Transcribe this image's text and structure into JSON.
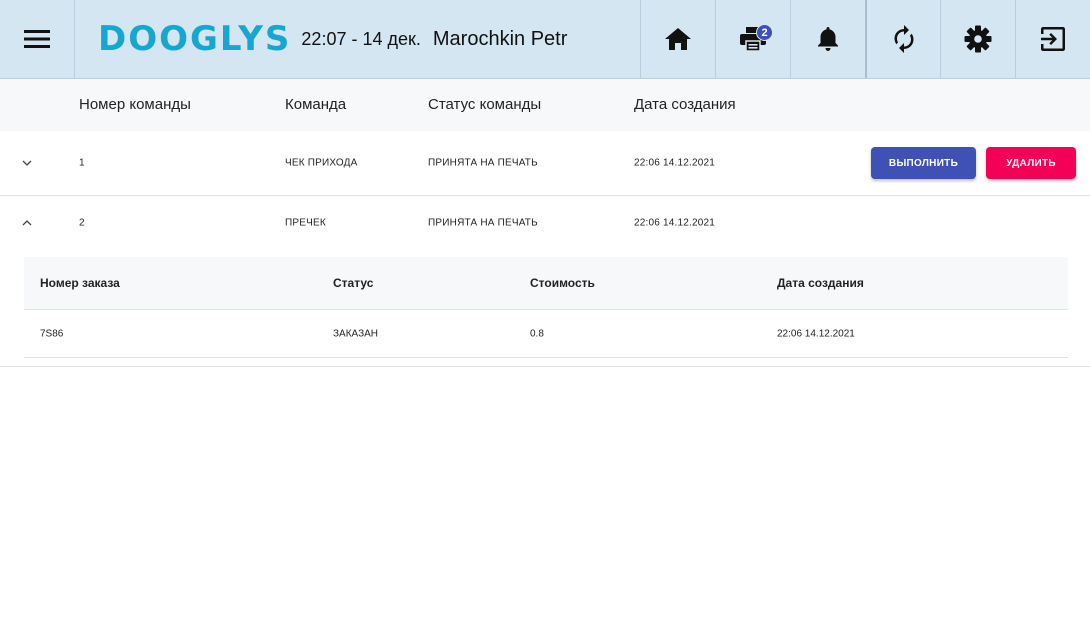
{
  "header": {
    "logo": "DOOGLYS",
    "datetime": "22:07 - 14 дек.",
    "username": "Marochkin Petr",
    "print_badge": "2",
    "icons": [
      "menu-icon",
      "home-icon",
      "printer-icon",
      "bell-icon",
      "sync-icon",
      "gear-icon",
      "logout-icon"
    ],
    "accent": "#17a6cf",
    "bg": "#d4e6f2"
  },
  "table": {
    "columns": [
      "Номер команды",
      "Команда",
      "Статус команды",
      "Дата создания"
    ],
    "rows": [
      {
        "number": "1",
        "command": "ЧЕК ПРИХОДА",
        "status": "ПРИНЯТА НА ПЕЧАТЬ",
        "created": "22:06 14.12.2021",
        "expanded": false,
        "exec_label": "ВЫПОЛНИТЬ",
        "delete_label": "УДАЛИТЬ"
      },
      {
        "number": "2",
        "command": "ПРЕЧЕК",
        "status": "ПРИНЯТА НА ПЕЧАТЬ",
        "created": "22:06 14.12.2021",
        "expanded": true
      }
    ]
  },
  "orders": {
    "columns": [
      "Номер заказа",
      "Статус",
      "Стоимость",
      "Дата создания"
    ],
    "rows": [
      {
        "number": "7S86",
        "status": "ЗАКАЗАН",
        "cost": "0.8",
        "created": "22:06 14.12.2021"
      }
    ]
  },
  "colors": {
    "execute_button": "#3f51b5",
    "delete_button": "#f50057",
    "badge": "#3f51b5"
  }
}
